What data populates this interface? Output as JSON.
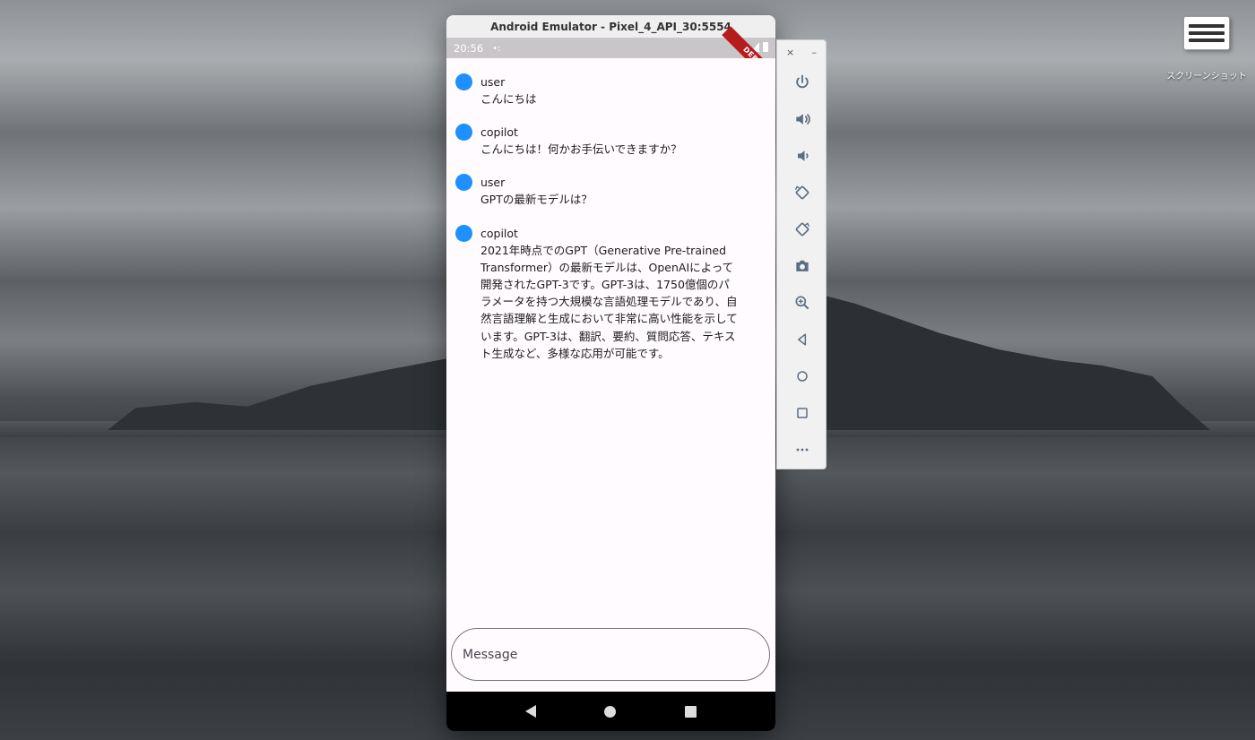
{
  "desktop": {
    "screenshot_label": "スクリーンショット"
  },
  "emulator": {
    "title": "Android Emulator - Pixel_4_API_30:5554",
    "status_time": "20:56",
    "debug_banner": "DEBUG"
  },
  "chat": {
    "messages": [
      {
        "role": "user",
        "text": "こんにちは"
      },
      {
        "role": "copilot",
        "text": "こんにちは！何かお手伝いできますか？"
      },
      {
        "role": "user",
        "text": "GPTの最新モデルは？"
      },
      {
        "role": "copilot",
        "text": "2021年時点でのGPT（Generative Pre-trained Transformer）の最新モデルは、OpenAIによって開発されたGPT-3です。GPT-3は、1750億個のパラメータを持つ大規模な言語処理モデルであり、自然言語理解と生成において非常に高い性能を示しています。GPT-3は、翻訳、要約、質問応答、テキスト生成など、多様な応用が可能です。"
      }
    ],
    "input_placeholder": "Message",
    "avatar_color": "#1e90ff"
  },
  "toolbar": {
    "close": "×",
    "minimize": "–",
    "buttons": [
      "power-icon",
      "volume-up-icon",
      "volume-down-icon",
      "rotate-left-icon",
      "rotate-right-icon",
      "camera-icon",
      "zoom-icon",
      "back-icon",
      "home-icon",
      "overview-icon",
      "more-icon"
    ]
  }
}
